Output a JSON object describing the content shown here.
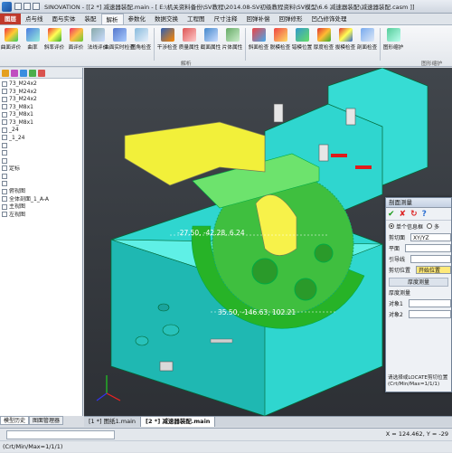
{
  "window": {
    "title": "SINOVATION - [[2 *] 减速器装配.main - [ E:\\机关资料备份\\SV教程\\2014.08-SV初级教程资料\\SV模型\\6.6 减速器装配\\减速器装配.casm ]]"
  },
  "menu": {
    "tabs": [
      "图层",
      "点与线",
      "面与实体",
      "装配",
      "解析",
      "参数化",
      "数据交换",
      "工程图",
      "尺寸注释",
      "回弹补偿",
      "回弹修形",
      "凹凸修饰处理"
    ]
  },
  "ribbon": {
    "buttons": [
      "曲面评价",
      "曲率",
      "斜率评价",
      "面评价",
      "法线评价",
      "曲面实时检查",
      "图角检查",
      "干涉检查",
      "质量属性",
      "截面属性",
      "片体属性",
      "斜面检查",
      "脱模检查",
      "错模位置",
      "厚度检查",
      "拔模检查",
      "剖面检查",
      "图形缩护"
    ],
    "group_label_left": "解析",
    "group_label_right": "图形缩护"
  },
  "left_panel": {
    "tree": [
      "73_M24x2",
      "73_M24x2",
      "73_M24x2",
      "73_M8x1",
      "73_M8x1",
      "73_M8x1",
      "_24",
      "_1_24",
      "",
      "",
      "",
      "定标",
      "",
      "",
      "俯视图",
      "全体剖面_1_A-A",
      "主视图",
      "左视图"
    ],
    "tabs": [
      "模型历史",
      "图面管理器"
    ]
  },
  "viewport": {
    "labels": {
      "coord_top": "-27.50, -42.28, 6.24",
      "coord_bottom": "35.50, -146.63, 102.21"
    }
  },
  "document_tabs": [
    "[1 *] 图纸1.main",
    "[2 *] 减速器装配.main"
  ],
  "dialog": {
    "title": "剖面测量",
    "tools": [
      "✔",
      "✘",
      "↻",
      "?"
    ],
    "mode_single": "单个信息框",
    "mode_multi": "多",
    "plane_label": "剪切面",
    "plane_value": "XY/YZ",
    "flat_label": "平面",
    "guide_label": "引导线",
    "cut_pos_label": "剪切位置",
    "cut_pos_value": "开始位置",
    "thickness_section": "厚度测量",
    "thickness_label": "厚度测量",
    "obj1": "对象1",
    "obj2": "对象2",
    "hint": "请选择或LOCATE剪切位置(Crt/Min/Max=1/1/1)"
  },
  "status": {
    "line1": "",
    "line2": "(Crt/Min/Max=1/1/1)",
    "coords": "X = 124.462, Y = -29"
  }
}
